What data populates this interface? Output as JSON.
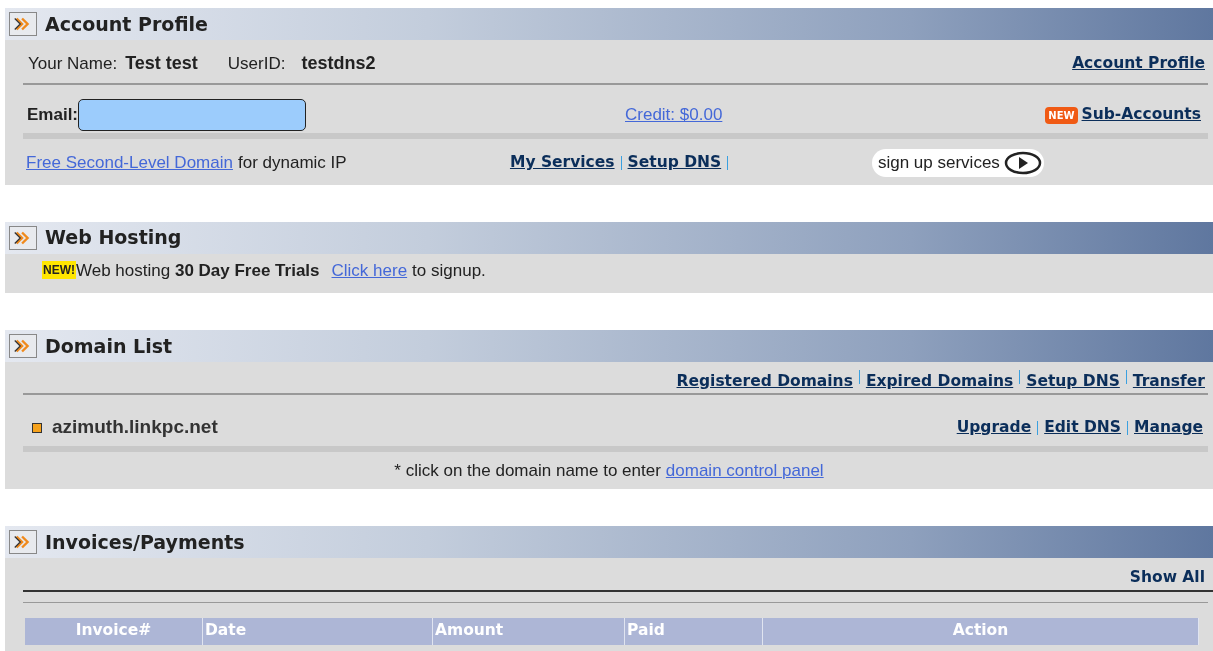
{
  "account_profile": {
    "title": "Account Profile",
    "name_label": "Your Name:",
    "name_value": "Test test",
    "userid_label": "UserID:",
    "userid_value": "testdns2",
    "profile_link": "Account Profile",
    "email_label": "Email:",
    "credit_link": "Credit: $0.00",
    "new_badge": "NEW",
    "subaccounts_link": "Sub-Accounts",
    "free_domain_link": "Free Second-Level Domain",
    "free_domain_text": "for dynamic IP",
    "nav_links": [
      "My Services",
      "Setup DNS"
    ],
    "signup_button": "sign up services"
  },
  "web_hosting": {
    "title": "Web Hosting",
    "new_badge": "NEW!",
    "text": "Web hosting **30 Day Free Trials**",
    "link": "Click here",
    "after_text": "to signup."
  },
  "domain_list": {
    "title": "Domain List",
    "nav_links": [
      "Registered Domains",
      "Expired Domains",
      "Setup DNS",
      "Transfer"
    ],
    "domains": [
      {
        "name": "azimuth.linkpc.net",
        "actions": [
          "Upgrade",
          "Edit DNS",
          "Manage"
        ]
      }
    ],
    "note": "* click on the domain name to enter",
    "note_link": "domain control panel"
  },
  "invoices": {
    "title": "Invoices/Payments",
    "show_all": "Show All",
    "columns": [
      "Invoice#",
      "Date",
      "Amount",
      "Paid",
      "Action"
    ]
  }
}
